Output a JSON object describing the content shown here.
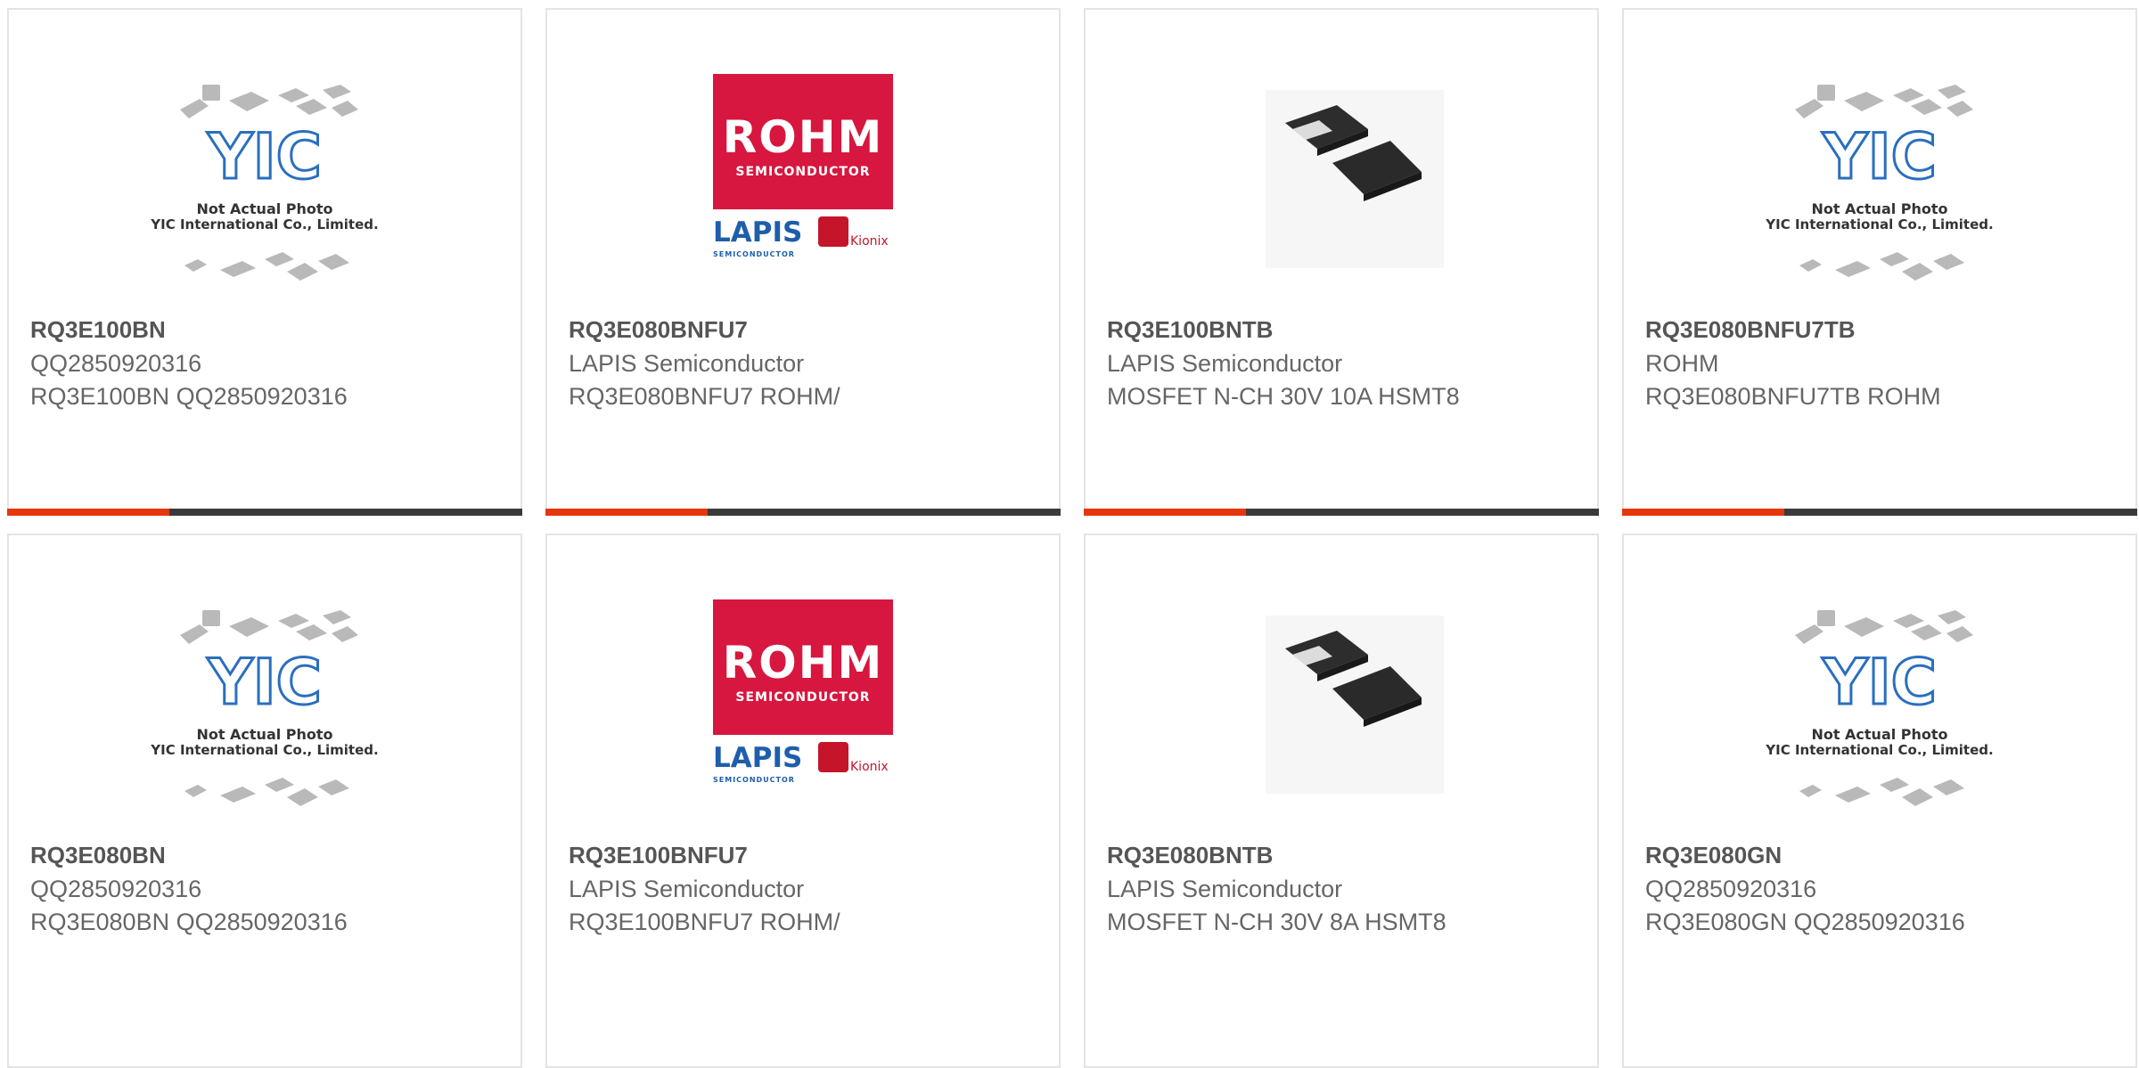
{
  "products": [
    {
      "part": "RQ3E100BN",
      "line1": "QQ2850920316",
      "line2": "RQ3E100BN QQ2850920316",
      "image": "yic-placeholder"
    },
    {
      "part": "RQ3E080BNFU7",
      "line1": "LAPIS Semiconductor",
      "line2": "RQ3E080BNFU7 ROHM/",
      "image": "rohm-logo"
    },
    {
      "part": "RQ3E100BNTB",
      "line1": "LAPIS Semiconductor",
      "line2": "MOSFET N-CH 30V 10A HSMT8",
      "image": "chip-photo"
    },
    {
      "part": "RQ3E080BNFU7TB",
      "line1": "ROHM",
      "line2": "RQ3E080BNFU7TB ROHM",
      "image": "yic-placeholder"
    },
    {
      "part": "RQ3E080BN",
      "line1": "QQ2850920316",
      "line2": "RQ3E080BN QQ2850920316",
      "image": "yic-placeholder"
    },
    {
      "part": "RQ3E100BNFU7",
      "line1": "LAPIS Semiconductor",
      "line2": "RQ3E100BNFU7 ROHM/",
      "image": "rohm-logo"
    },
    {
      "part": "RQ3E080BNTB",
      "line1": "LAPIS Semiconductor",
      "line2": "MOSFET N-CH 30V 8A HSMT8",
      "image": "chip-photo"
    },
    {
      "part": "RQ3E080GN",
      "line1": "QQ2850920316",
      "line2": "RQ3E080GN QQ2850920316",
      "image": "yic-placeholder"
    }
  ],
  "logos": {
    "rohm": "ROHM",
    "rohm_sub": "SEMICONDUCTOR",
    "lapis": "LAPIS",
    "lapis_sub": "SEMICONDUCTOR",
    "kionix": "Kionix",
    "yic": "YIC",
    "yic_caption1": "Not Actual Photo",
    "yic_caption2": "YIC International Co., Limited."
  },
  "colors": {
    "accent": "#e6360b",
    "bar": "#3a3a3a",
    "rohm_red": "#d7173f",
    "lapis_blue": "#1e5eab",
    "yic_blue": "#2a6fbf"
  }
}
